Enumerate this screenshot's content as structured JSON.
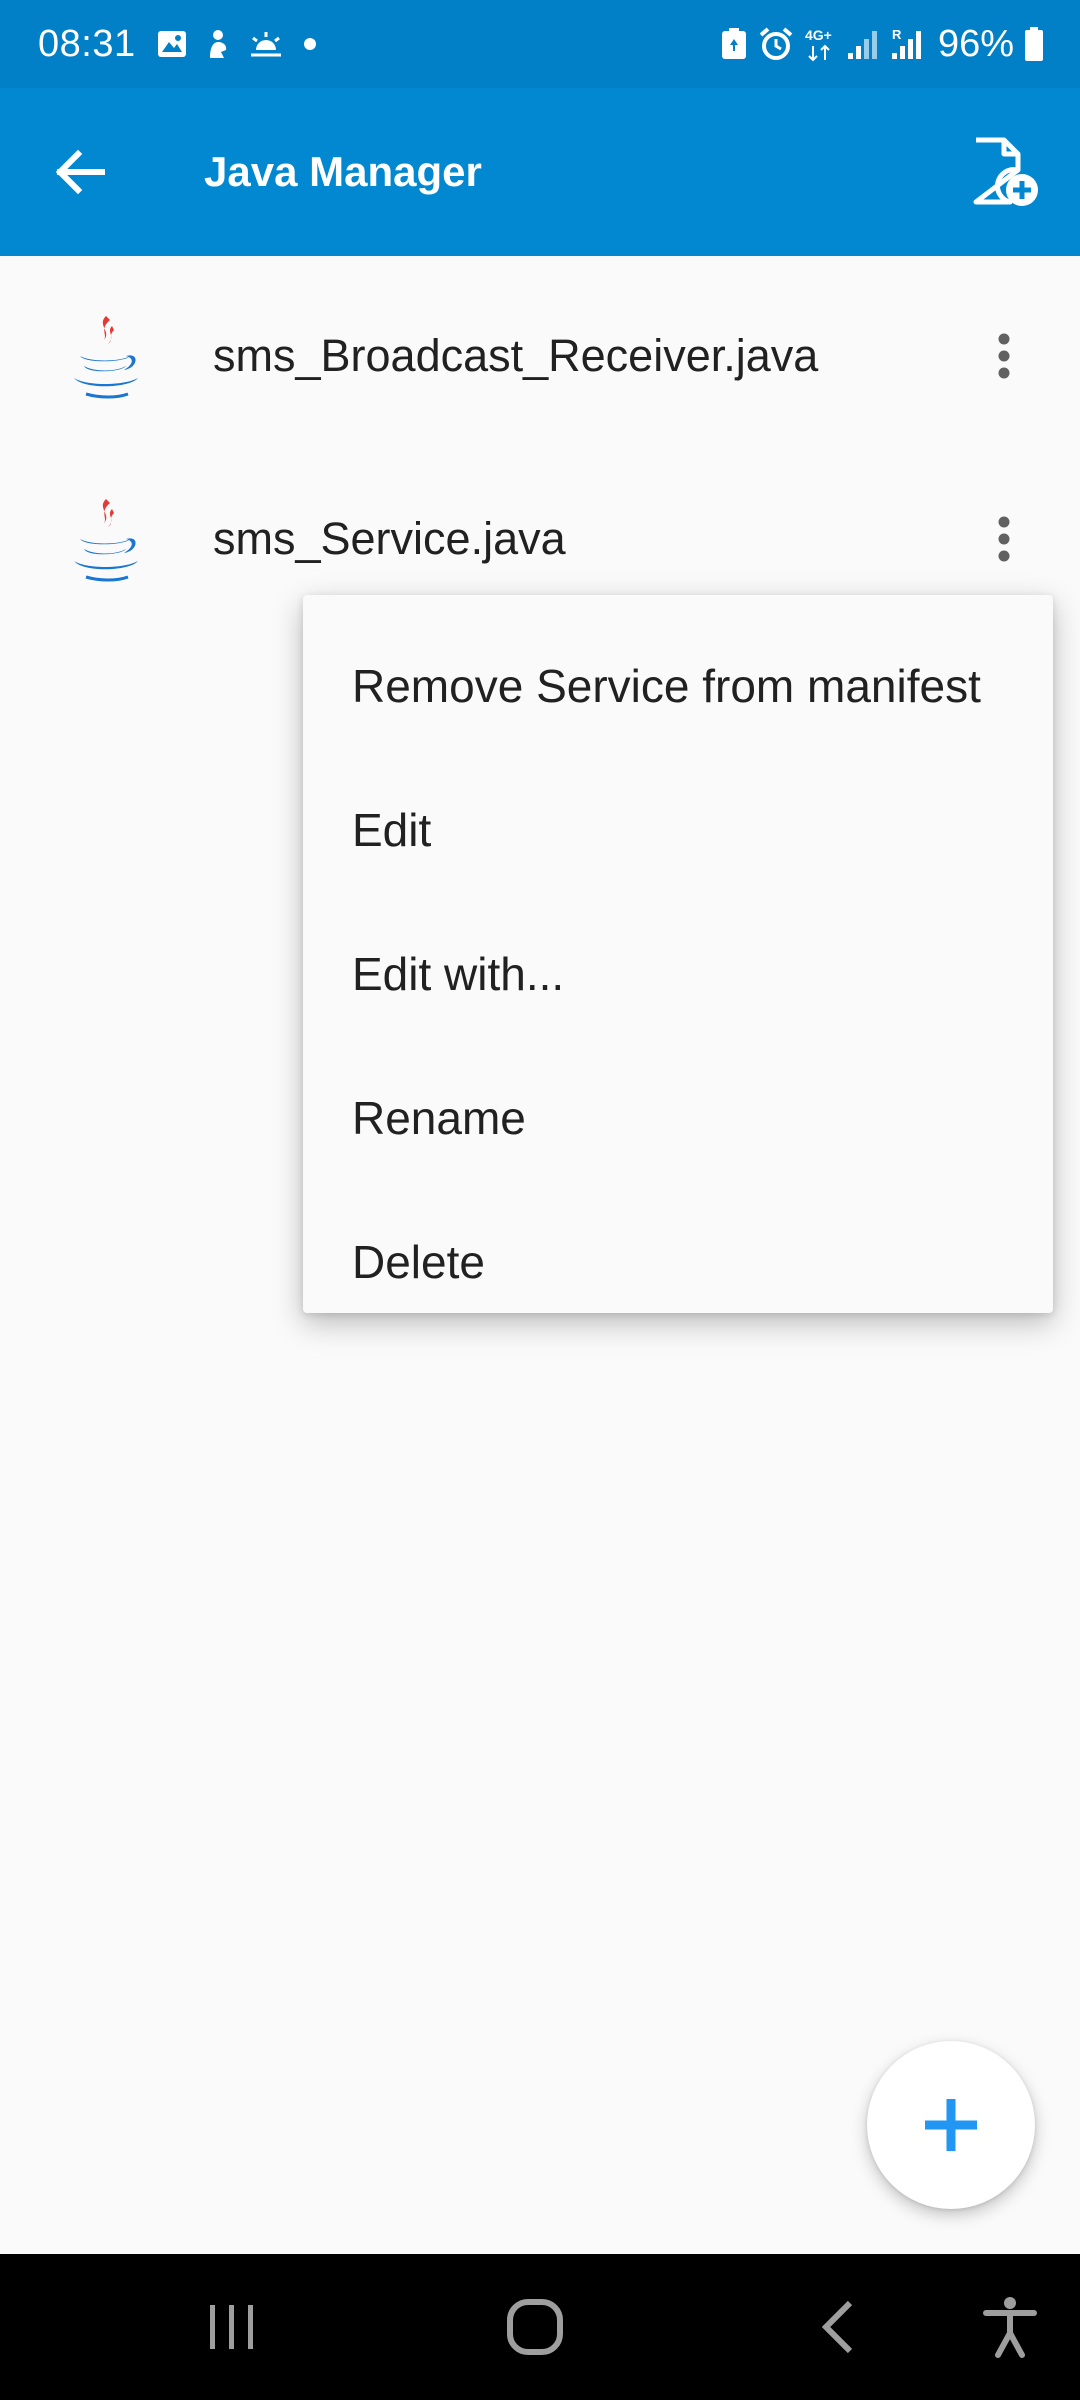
{
  "status_bar": {
    "time": "08:31",
    "battery": "96%",
    "left_icons": [
      "gallery-icon",
      "person-icon",
      "weather-icon",
      "dot-icon"
    ],
    "right_icons": [
      "battery-saver-icon",
      "alarm-icon",
      "4g-icon",
      "signal-icon",
      "roaming-signal-icon",
      "battery-icon"
    ],
    "network_label": "4G+",
    "roaming_label": "R"
  },
  "app_bar": {
    "title": "Java Manager",
    "back_icon": "arrow-back-icon",
    "action_icon": "new-file-icon"
  },
  "files": [
    {
      "name": "sms_Broadcast_Receiver.java",
      "icon": "java-icon"
    },
    {
      "name": "sms_Service.java",
      "icon": "java-icon"
    }
  ],
  "menu": {
    "items": [
      {
        "label": "Remove Service from manifest"
      },
      {
        "label": "Edit"
      },
      {
        "label": "Edit with..."
      },
      {
        "label": "Rename"
      },
      {
        "label": "Delete"
      }
    ]
  },
  "fab": {
    "icon": "add-icon"
  },
  "nav_bar": {
    "icons": [
      "recent-apps-icon",
      "home-icon",
      "back-icon",
      "accessibility-icon"
    ]
  },
  "colors": {
    "status_bar": "#0280c7",
    "app_bar": "#0288d1",
    "background": "#fafafa",
    "accent": "#2196f3",
    "text": "#212121",
    "nav_bar": "#000000"
  }
}
